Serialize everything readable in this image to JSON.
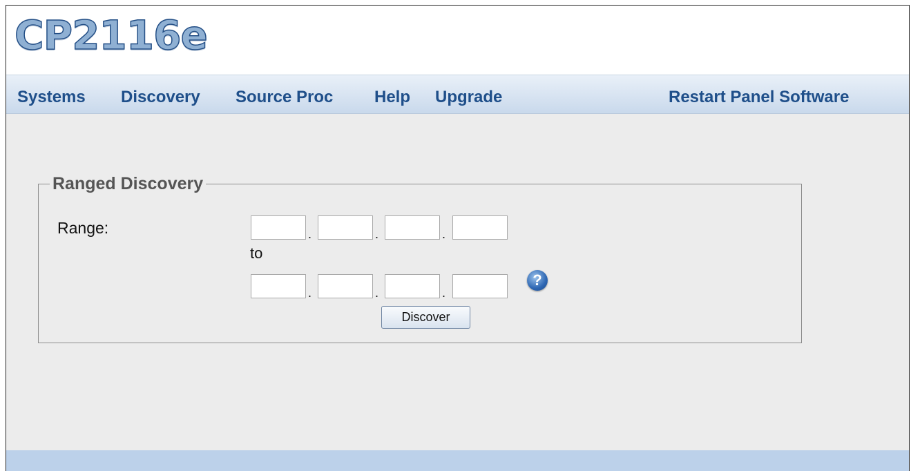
{
  "app": {
    "logo_text": "CP2116e"
  },
  "nav": {
    "items": [
      "Systems",
      "Discovery",
      "Source Proc",
      "Help",
      "Upgrade"
    ],
    "restart_label": "Restart Panel Software"
  },
  "ranged_discovery": {
    "legend": "Ranged Discovery",
    "range_label": "Range:",
    "to_label": "to",
    "start_ip": [
      "",
      "",
      "",
      ""
    ],
    "end_ip": [
      "",
      "",
      "",
      ""
    ],
    "octet_separator": ".",
    "help_icon": "question-circle-icon",
    "help_glyph": "?",
    "discover_button": "Discover"
  },
  "colors": {
    "nav_text": "#1f4f8a",
    "nav_bar": "#c9d9ec",
    "content_bg": "#ececec",
    "footer_bar": "#bcd1ea"
  }
}
